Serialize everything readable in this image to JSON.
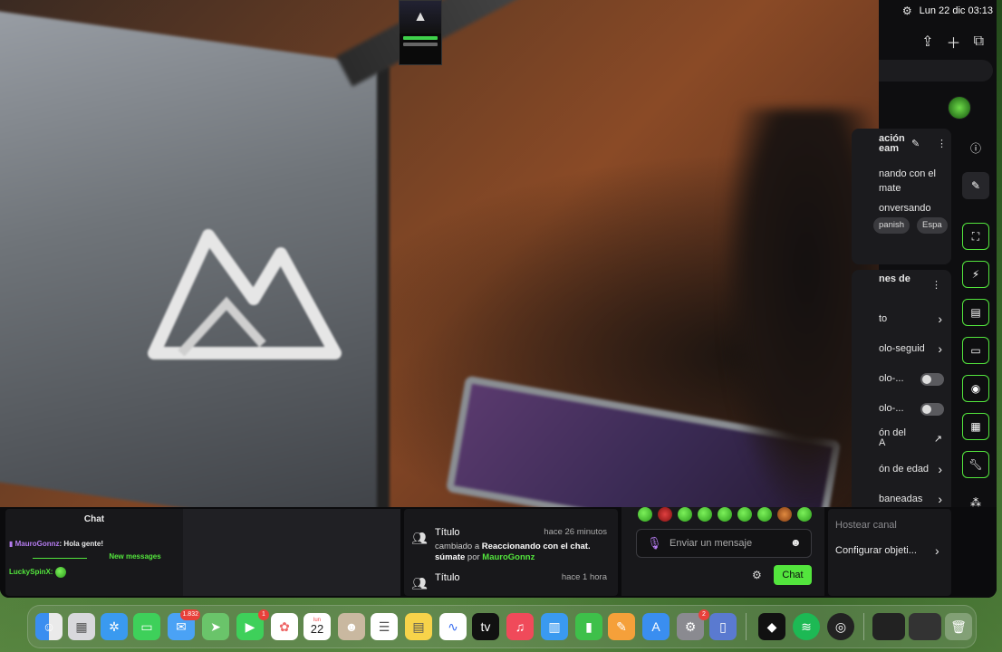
{
  "menubar": {
    "date_time": "Lun 22 dic  03:13"
  },
  "stream_info": {
    "heading": "ación\neam",
    "title_fragment": "nando con el",
    "title_fragment2": "mate",
    "category": "onversando",
    "tags": [
      "panish",
      "Espa"
    ]
  },
  "stream_actions": {
    "heading": "nes de",
    "rows": [
      {
        "label": "to",
        "control": "chevron"
      },
      {
        "label": "olo-seguid",
        "control": "chevron"
      },
      {
        "label": "olo-...",
        "control": "toggle"
      },
      {
        "label": "olo-...",
        "control": "toggle"
      },
      {
        "label": "ón del\nA",
        "control": "external"
      },
      {
        "label": "ón de edad",
        "control": "chevron"
      },
      {
        "label": "baneadas",
        "control": "chevron"
      }
    ]
  },
  "chat": {
    "title": "Chat",
    "messages": [
      {
        "user": "MauroGonnz",
        "text": ": Hola gente!"
      }
    ],
    "new_messages_label": "New messages",
    "last_user": "LuckySpinX:"
  },
  "activity": [
    {
      "title": "Título",
      "time": "hace 26 minutos",
      "desc_prefix": "cambiado a",
      "desc_bold": "Reaccionando con el chat. súmate",
      "desc_by": "por",
      "desc_user": "MauroGonnz"
    },
    {
      "title": "Título",
      "time": "hace 1 hora",
      "desc_prefix": "",
      "desc_bold": "",
      "desc_by": "",
      "desc_user": ""
    }
  ],
  "composer": {
    "placeholder": "Enviar un mensaje",
    "send_label": "Chat"
  },
  "host_panel": {
    "host_label": "Hostear canal",
    "goals_label": "Configurar objeti..."
  },
  "dock": {
    "mail_badge": "1.832",
    "facetime_badge": "1",
    "calendar_month": "lun",
    "calendar_day": "22",
    "settings_badge": "2"
  },
  "colors": {
    "accent": "#53e53d",
    "panel": "#18181b",
    "background": "#0e0e10"
  }
}
